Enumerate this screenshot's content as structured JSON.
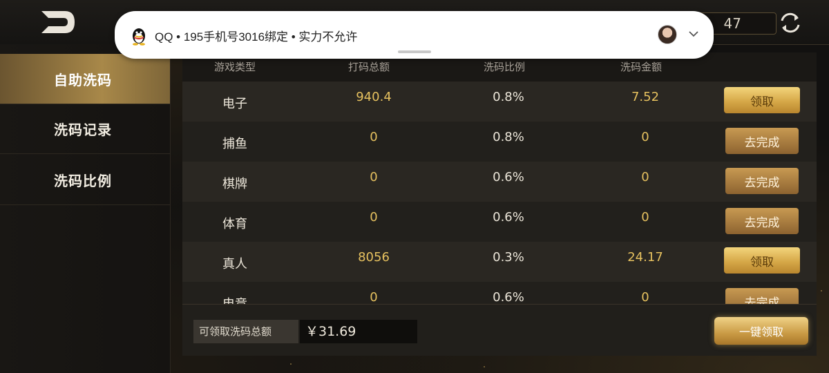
{
  "notification": {
    "text": "QQ • 195手机号3016绑定 • 实力不允许"
  },
  "header": {
    "balance_partial": "47"
  },
  "sidebar": {
    "items": [
      {
        "label": "自助洗码"
      },
      {
        "label": "洗码记录"
      },
      {
        "label": "洗码比例"
      }
    ]
  },
  "table": {
    "headers": [
      "游戏类型",
      "打码总额",
      "洗码比例",
      "洗码金额"
    ],
    "rows": [
      {
        "type": "电子",
        "bet_total": "940.4",
        "ratio": "0.8%",
        "amount": "7.52",
        "action": "领取"
      },
      {
        "type": "捕鱼",
        "bet_total": "0",
        "ratio": "0.8%",
        "amount": "0",
        "action": "去完成"
      },
      {
        "type": "棋牌",
        "bet_total": "0",
        "ratio": "0.6%",
        "amount": "0",
        "action": "去完成"
      },
      {
        "type": "体育",
        "bet_total": "0",
        "ratio": "0.6%",
        "amount": "0",
        "action": "去完成"
      },
      {
        "type": "真人",
        "bet_total": "8056",
        "ratio": "0.3%",
        "amount": "24.17",
        "action": "领取"
      },
      {
        "type": "电竞",
        "bet_total": "0",
        "ratio": "0.6%",
        "amount": "0",
        "action": "去完成"
      }
    ]
  },
  "footer": {
    "total_label": "可领取洗码总额",
    "total_value": "￥31.69",
    "one_key_label": "一键领取"
  },
  "colors": {
    "gold_accent": "#e6c15f",
    "active_tab": "#a88849",
    "background": "#121110"
  }
}
